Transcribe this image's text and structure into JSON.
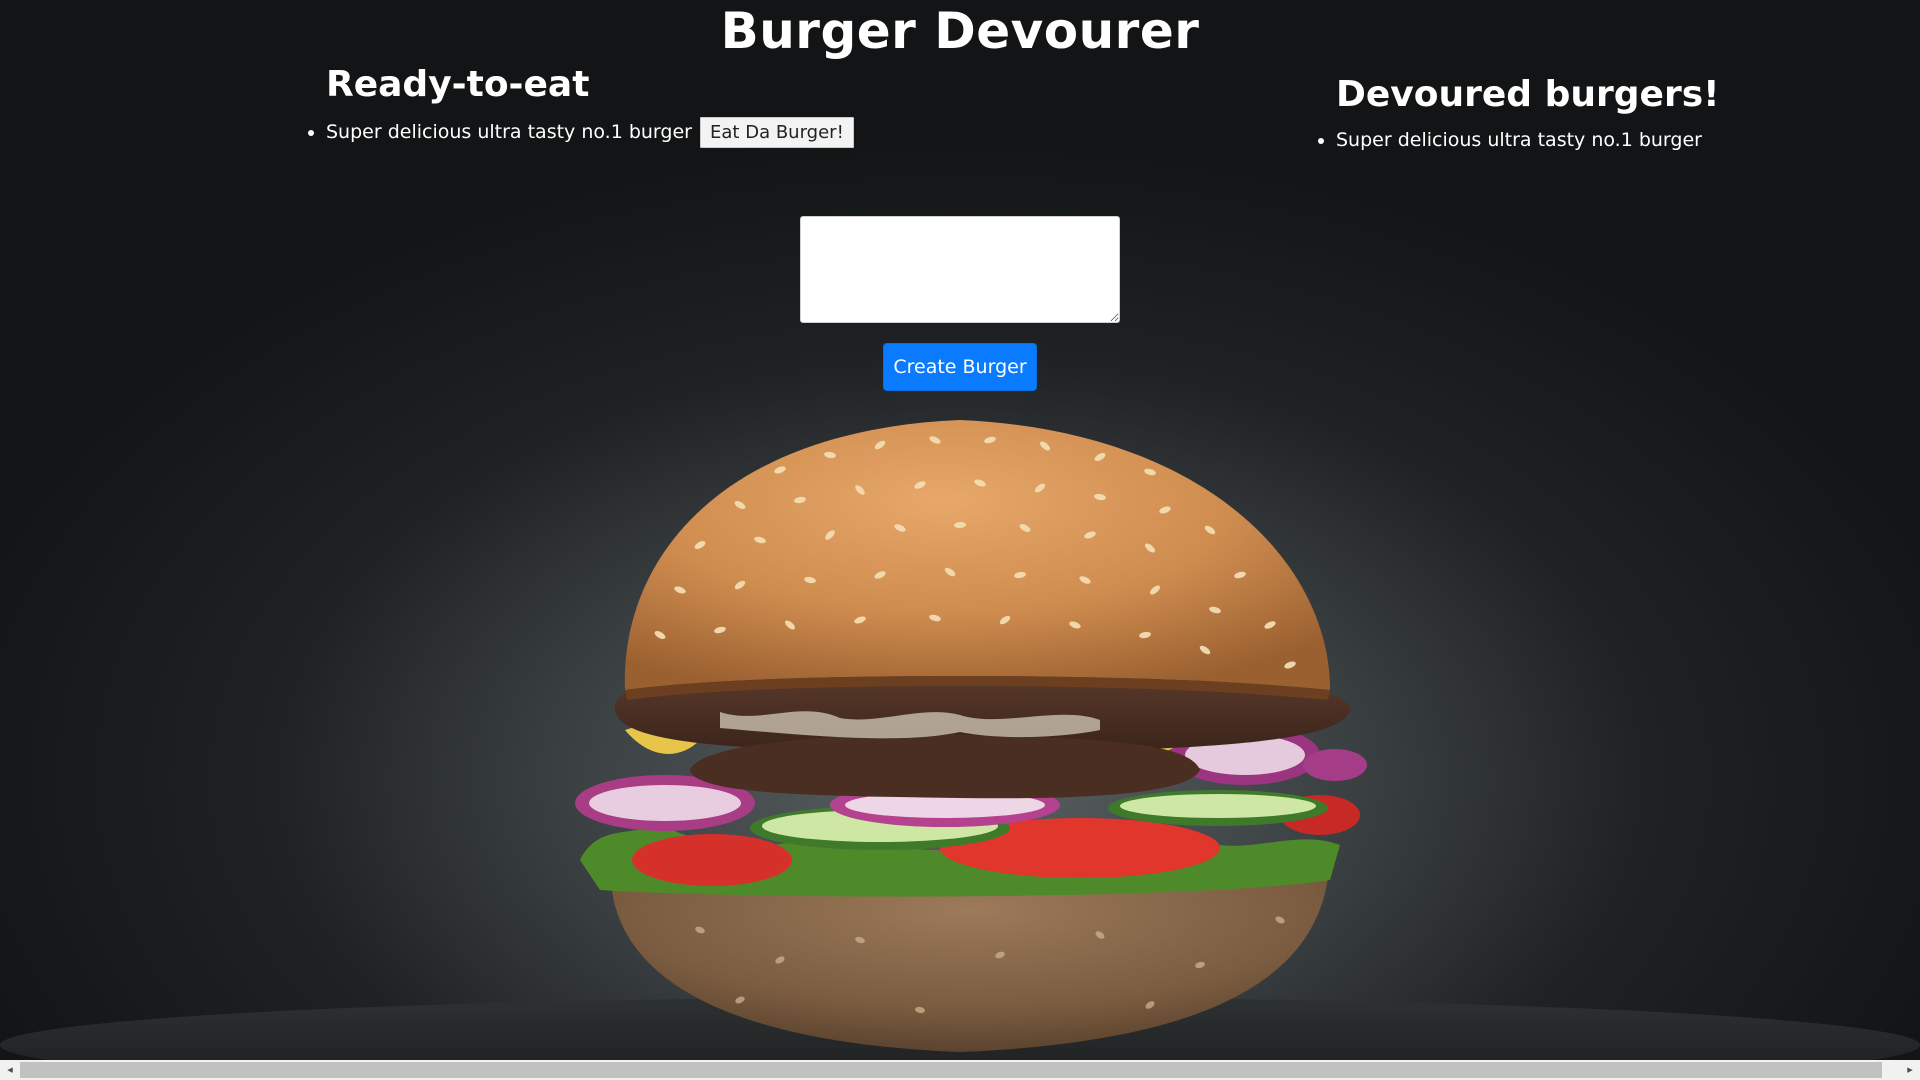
{
  "header": {
    "title": "Burger Devourer"
  },
  "ready": {
    "heading": "Ready-to-eat",
    "items": [
      {
        "name": "Super delicious ultra tasty no.1 burger",
        "button_label": "Eat Da Burger!"
      }
    ]
  },
  "devoured": {
    "heading": "Devoured burgers!",
    "items": [
      {
        "name": "Super delicious ultra tasty no.1 burger"
      }
    ]
  },
  "form": {
    "textarea_value": "",
    "submit_label": "Create Burger"
  },
  "scrollbar": {
    "left_arrow": "◂",
    "right_arrow": "▸"
  },
  "colors": {
    "background": "#1a1c1d",
    "primary_button": "#0a7bff",
    "text": "#ffffff"
  },
  "icons": {
    "background_image": "burger-illustration"
  }
}
